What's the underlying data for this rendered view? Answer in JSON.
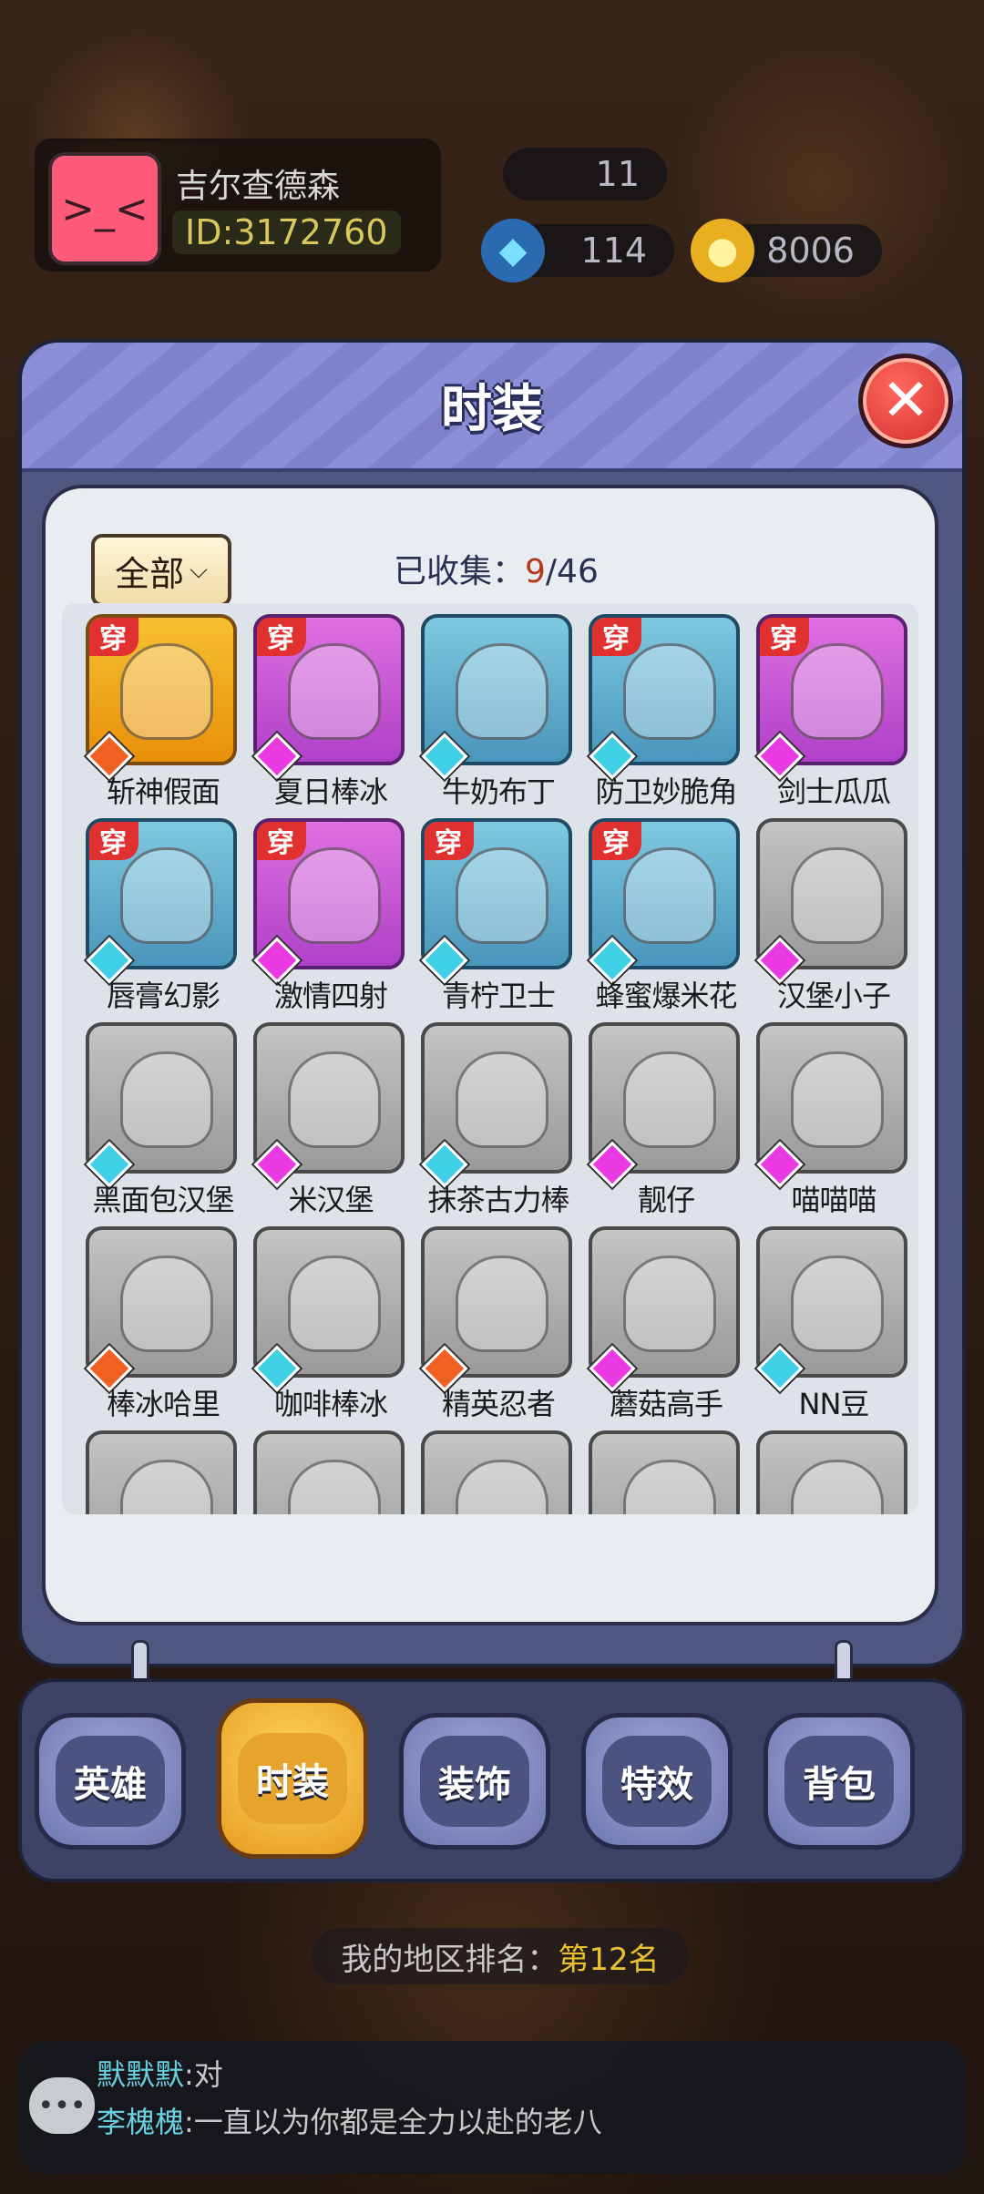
{
  "player": {
    "name": "吉尔查德森",
    "id": "ID:3172760"
  },
  "stats": {
    "level": "11",
    "gems": "114",
    "coins": "8006"
  },
  "modal": {
    "title": "时装",
    "close": "✕"
  },
  "filter": {
    "label": "全部",
    "chevron": "⌵"
  },
  "collection": {
    "label": "已收集：",
    "current": "9",
    "total": "/46"
  },
  "wear_tag": "穿",
  "items": [
    {
      "name": "斩神假面",
      "bg": "orange",
      "rarity": "orange",
      "worn": true
    },
    {
      "name": "夏日棒冰",
      "bg": "purple",
      "rarity": "pink",
      "worn": true
    },
    {
      "name": "牛奶布丁",
      "bg": "blue",
      "rarity": "blue",
      "worn": false
    },
    {
      "name": "防卫妙脆角",
      "bg": "blue",
      "rarity": "blue",
      "worn": true
    },
    {
      "name": "剑士瓜瓜",
      "bg": "purple",
      "rarity": "pink",
      "worn": true
    },
    {
      "name": "唇膏幻影",
      "bg": "blue",
      "rarity": "blue",
      "worn": true
    },
    {
      "name": "激情四射",
      "bg": "purple",
      "rarity": "pink",
      "worn": true
    },
    {
      "name": "青柠卫士",
      "bg": "blue",
      "rarity": "blue",
      "worn": true
    },
    {
      "name": "蜂蜜爆米花",
      "bg": "blue",
      "rarity": "blue",
      "worn": true
    },
    {
      "name": "汉堡小子",
      "bg": "grey",
      "rarity": "pink",
      "worn": false
    },
    {
      "name": "黑面包汉堡",
      "bg": "grey",
      "rarity": "blue",
      "worn": false
    },
    {
      "name": "米汉堡",
      "bg": "grey",
      "rarity": "pink",
      "worn": false
    },
    {
      "name": "抹茶古力棒",
      "bg": "grey",
      "rarity": "blue",
      "worn": false
    },
    {
      "name": "靓仔",
      "bg": "grey",
      "rarity": "pink",
      "worn": false
    },
    {
      "name": "喵喵喵",
      "bg": "grey",
      "rarity": "pink",
      "worn": false
    },
    {
      "name": "棒冰哈里",
      "bg": "grey",
      "rarity": "orange",
      "worn": false
    },
    {
      "name": "咖啡棒冰",
      "bg": "grey",
      "rarity": "blue",
      "worn": false
    },
    {
      "name": "精英忍者",
      "bg": "grey",
      "rarity": "orange",
      "worn": false
    },
    {
      "name": "蘑菇高手",
      "bg": "grey",
      "rarity": "pink",
      "worn": false
    },
    {
      "name": "NN豆",
      "bg": "grey",
      "rarity": "blue",
      "worn": false
    },
    {
      "name": "",
      "bg": "grey",
      "rarity": "blue",
      "worn": false
    },
    {
      "name": "",
      "bg": "grey",
      "rarity": "pink",
      "worn": false
    },
    {
      "name": "",
      "bg": "grey",
      "rarity": "blue",
      "worn": false
    },
    {
      "name": "",
      "bg": "grey",
      "rarity": "blue",
      "worn": false
    },
    {
      "name": "",
      "bg": "grey",
      "rarity": "pink",
      "worn": false
    }
  ],
  "tabs": [
    {
      "label": "英雄",
      "active": false
    },
    {
      "label": "时装",
      "active": true
    },
    {
      "label": "装饰",
      "active": false
    },
    {
      "label": "特效",
      "active": false
    },
    {
      "label": "背包",
      "active": false
    }
  ],
  "rank": {
    "label": "我的地区排名：",
    "value": "第12名"
  },
  "chat": [
    {
      "who": "默默默",
      "text": ":对"
    },
    {
      "who": "李槐槐",
      "text": ":一直以为你都是全力以赴的老八"
    }
  ],
  "colors": {
    "accent_red": "#e03030",
    "gold": "#e6a42c",
    "modal": "#4f5680"
  }
}
